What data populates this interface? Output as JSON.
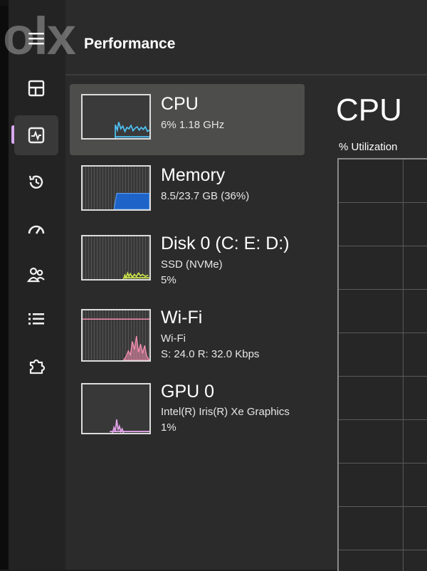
{
  "app": {
    "page_title": "Performance",
    "watermark_text": "olx"
  },
  "nav": [
    {
      "id": "menu",
      "icon": "hamburger-icon"
    },
    {
      "id": "processes",
      "icon": "processes-icon"
    },
    {
      "id": "performance",
      "icon": "performance-icon",
      "selected": true
    },
    {
      "id": "app-history",
      "icon": "history-icon"
    },
    {
      "id": "startup-apps",
      "icon": "speedometer-icon"
    },
    {
      "id": "users",
      "icon": "users-icon"
    },
    {
      "id": "details",
      "icon": "list-icon"
    },
    {
      "id": "services",
      "icon": "puzzle-icon"
    }
  ],
  "devices": [
    {
      "name": "CPU",
      "line1": "6%  1.18 GHz",
      "line2": "",
      "graph_color": "#4fc3f7",
      "selected": true
    },
    {
      "name": "Memory",
      "line1": "8.5/23.7 GB (36%)",
      "line2": "",
      "graph_color": "#1565c0",
      "usage_fraction": 0.36
    },
    {
      "name": "Disk 0 (C: E: D:)",
      "line1": "SSD (NVMe)",
      "line2": "5%",
      "graph_color": "#c6e04a"
    },
    {
      "name": "Wi-Fi",
      "line1": "Wi-Fi",
      "line2": "S: 24.0  R: 32.0 Kbps",
      "graph_color": "#f48fb1"
    },
    {
      "name": "GPU 0",
      "line1": "Intel(R) Iris(R) Xe Graphics",
      "line2": "1%",
      "graph_color": "#e1a3e8"
    }
  ],
  "detail": {
    "title": "CPU",
    "graph_label": "% Utilization"
  },
  "colors": {
    "background": "#2b2b2b",
    "sidebar": "#232323",
    "selected_item": "#4d4d4b",
    "accent_indicator": "#d8a8f0"
  }
}
